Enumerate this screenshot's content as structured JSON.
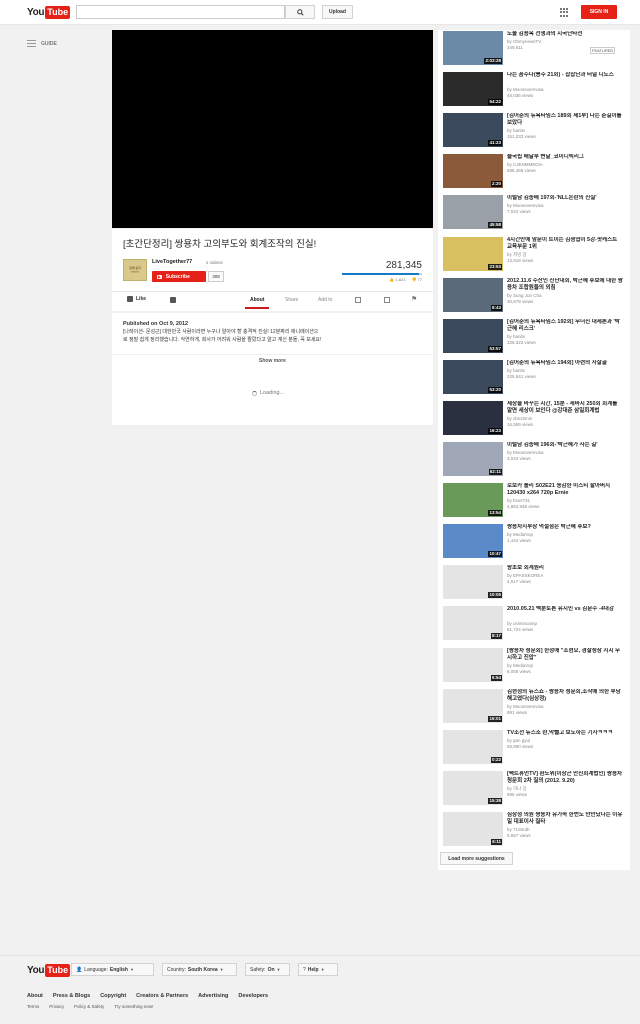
{
  "masthead": {
    "logo_you": "You",
    "logo_tube": "Tube",
    "search_placeholder": "",
    "upload_label": "Upload",
    "signin_label": "SIGN IN"
  },
  "guide": {
    "label": "GUIDE"
  },
  "video": {
    "title": "[초간단정리] 쌍용차 고의부도와 회계조작의 진실!",
    "channel_name": "LiveTogether77",
    "channel_thumb_text_1": "함께 살자",
    "channel_thumb_text_2": "YYYY",
    "video_count": "2 videos",
    "subscribe_label": "Subscribe",
    "subscriber_count": "308",
    "view_count": "281,345",
    "likes": "1,821",
    "dislikes": "77",
    "like_ratio": 0.959,
    "like_label": "Like",
    "tabs": [
      "About",
      "Share",
      "Add to"
    ],
    "published": "Published on Oct 9, 2012",
    "description": "[나레이션- 문성근] 대한민국 사람이라면 누구나 알아야 할 충격적 진실! 12분짜리 애니메이션으로 정말 쉽게 정리했습니다. 악연하게, 회사가 어려워 사람을 짤랐다고 알고 계신 분들, 꼭 보세요!",
    "show_more": "Show more",
    "loading": "Loading..."
  },
  "sidebar": {
    "featured_label": "FEATURED",
    "items": [
      {
        "title": "도올 김용옥 선생과의 시국난타전",
        "by": "by OhmynewsTV",
        "views": "349,611",
        "duration": "2:03:28"
      },
      {
        "title": "나는 꼼수다(봉주 21회) - 삽잡단과 터널 디도스",
        "by": "by Mooneverevisa",
        "views": "45,036 views",
        "duration": "54:22"
      },
      {
        "title": "[김어준의 뉴욕타임스 189회 제1부] 나는 준길이를 보았다",
        "by": "by hanitv",
        "views": "151,233 views",
        "duration": "41:23"
      },
      {
        "title": "줄국립 배달부 변달_코미디빅리그",
        "by": "by CJENMMEDIA",
        "views": "586,468 views",
        "duration": "2:20"
      },
      {
        "title": "이털남 김종배 197회-'NLL논란의 진실'",
        "by": "by Mooneverevisa",
        "views": "7,022 views",
        "duration": "45:58"
      },
      {
        "title": "4시간만에 앞문이 트이는 김셩엽이 5강-팟캐스트 교육부문 1위",
        "by": "by 저잉 강",
        "views": "13,918 views",
        "duration": "23:53"
      },
      {
        "title": "2012.11.6 수산인 진단대회, 박근혜 후보에 대한 쌍용차 조합원들의 외침",
        "by": "by Sung Jun Cha",
        "views": "30,679 views",
        "duration": "8:43"
      },
      {
        "title": "[김어준의 뉴욕타임스 192회] 무너진 대세론과 '박근혜 리스크'",
        "by": "by hanitv",
        "views": "326,323 views",
        "duration": "53:57"
      },
      {
        "title": "[김어준의 뉴욕타임스 194회] 아련의 자살골",
        "by": "by hanitv",
        "views": "225,641 views",
        "duration": "53:20"
      },
      {
        "title": "세상을 바꾸는 시간, 15분 - 세바시 250회 회계를 알면 세상이 보인다 @강대준 삼일회계법",
        "by": "by cbs15min",
        "views": "16,559 views",
        "duration": "16:23"
      },
      {
        "title": "이털남 김종배 196회-'박근혜가 사는 길'",
        "by": "by Mooneverevisa",
        "views": "3,043 views",
        "duration": "52:11"
      },
      {
        "title": "로보카 폴리 S02E21 용감한 미스티 할아버지 120430 x264 720p Ernie",
        "by": "by hsos731",
        "views": "4,862,948 views",
        "duration": "13:54"
      },
      {
        "title": "쌍용차지부장 먹설점은 박근혜 후보?",
        "by": "by MediaVop",
        "views": "1,444 views",
        "duration": "10:47"
      },
      {
        "title": "왕초보 회계원리",
        "by": "by EPASSKOREA",
        "views": "4,517 views",
        "duration": "10:05"
      },
      {
        "title": "2010.05.21 백분토론 유시민 vs 김문수 -4대강",
        "by": "by usimincamp",
        "views": "61,724 views",
        "duration": "8:17"
      },
      {
        "title": "[쌍용차 청문회] 한정애 \"조현오, 경찰청장 지시 무시하고 진압\"",
        "by": "by MediaVop",
        "views": "6,056 views",
        "duration": "6:54"
      },
      {
        "title": "김현정의 뉴스쇼 - 쌍용차 청문회,조작에 의한 부당해고였다(심상정)",
        "by": "by Mooneverevisa",
        "views": "891 views",
        "duration": "16:01"
      },
      {
        "title": "TV조선 뉴스소 란,막뺄고 보도하는 기자ㅋㅋㅋ",
        "by": "by gan gyul",
        "views": "55,990 views",
        "duration": "0:22"
      },
      {
        "title": "[팩트휴먼TV] 환노위(이상곤 안진회계법인) 쌍용차청문회 2차 질의 (2012. 9.20)",
        "by": "by 하나 강",
        "views": "896 views",
        "duration": "15:38"
      },
      {
        "title": "심상정 의원 쌍용차 유가족 한번도 만안났다는 이유일 대표이사 질타",
        "by": "by 710truth",
        "views": "9,557 views",
        "duration": "6:11"
      }
    ],
    "load_more": "Load more suggestions"
  },
  "footer": {
    "language_label": "Language:",
    "language_value": "English",
    "country_label": "Country:",
    "country_value": "South Korea",
    "safety_label": "Safety:",
    "safety_value": "On",
    "help_label": "Help",
    "links_primary": [
      "About",
      "Press & Blogs",
      "Copyright",
      "Creators & Partners",
      "Advertising",
      "Developers"
    ],
    "links_secondary": [
      "Terms",
      "Privacy",
      "Policy & Safety",
      "Try something new!"
    ]
  },
  "colors": {
    "brand_red": "#e62117",
    "like_blue": "#167ac6",
    "tab_red": "#cc181e"
  }
}
